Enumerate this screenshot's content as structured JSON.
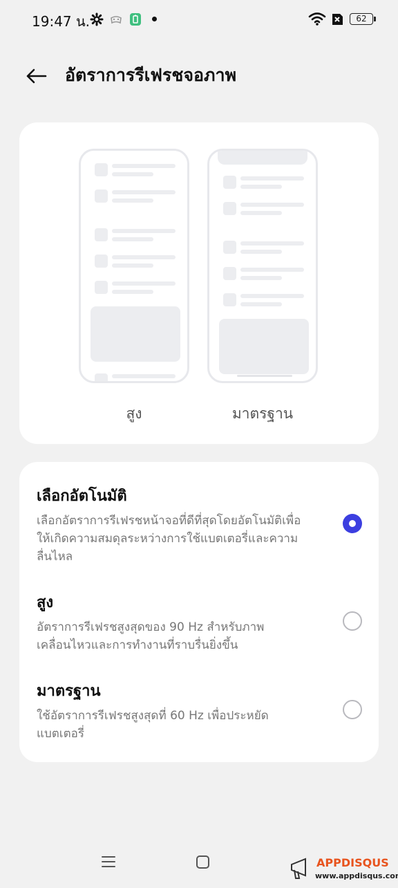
{
  "status_bar": {
    "time": "19:47 น.",
    "battery_level": "62",
    "icons": [
      "gear-icon",
      "game-icon",
      "battery-saver-icon",
      "notification-dot-icon",
      "wifi-icon",
      "no-sim-icon",
      "battery-icon"
    ]
  },
  "header": {
    "back_icon": "arrow-left-icon",
    "title": "อัตราการรีเฟรชจอภาพ"
  },
  "preview": {
    "high_label": "สูง",
    "standard_label": "มาตรฐาน"
  },
  "options": [
    {
      "title": "เลือกอัตโนมัติ",
      "description": "เลือกอัตราการรีเฟรชหน้าจอที่ดีที่สุดโดยอัตโนมัติเพื่อให้เกิดความสมดุลระหว่างการใช้แบตเตอรี่และความลื่นไหล",
      "selected": true
    },
    {
      "title": "สูง",
      "description": "อัตราการรีเฟรชสูงสุดของ 90 Hz สำหรับภาพเคลื่อนไหวและการทำงานที่ราบรื่นยิ่งขึ้น",
      "selected": false
    },
    {
      "title": "มาตรฐาน",
      "description": "ใช้อัตราการรีเฟรชสูงสุดที่ 60 Hz เพื่อประหยัดแบตเตอรี่",
      "selected": false
    }
  ],
  "nav_bar": {
    "icons": [
      "menu-icon",
      "home-icon"
    ]
  },
  "watermark": {
    "brand": "APPDISQUS",
    "url": "www.appdisqus.com"
  },
  "colors": {
    "accent": "#3c3fe0",
    "background": "#f1f1f1",
    "card": "#ffffff"
  }
}
